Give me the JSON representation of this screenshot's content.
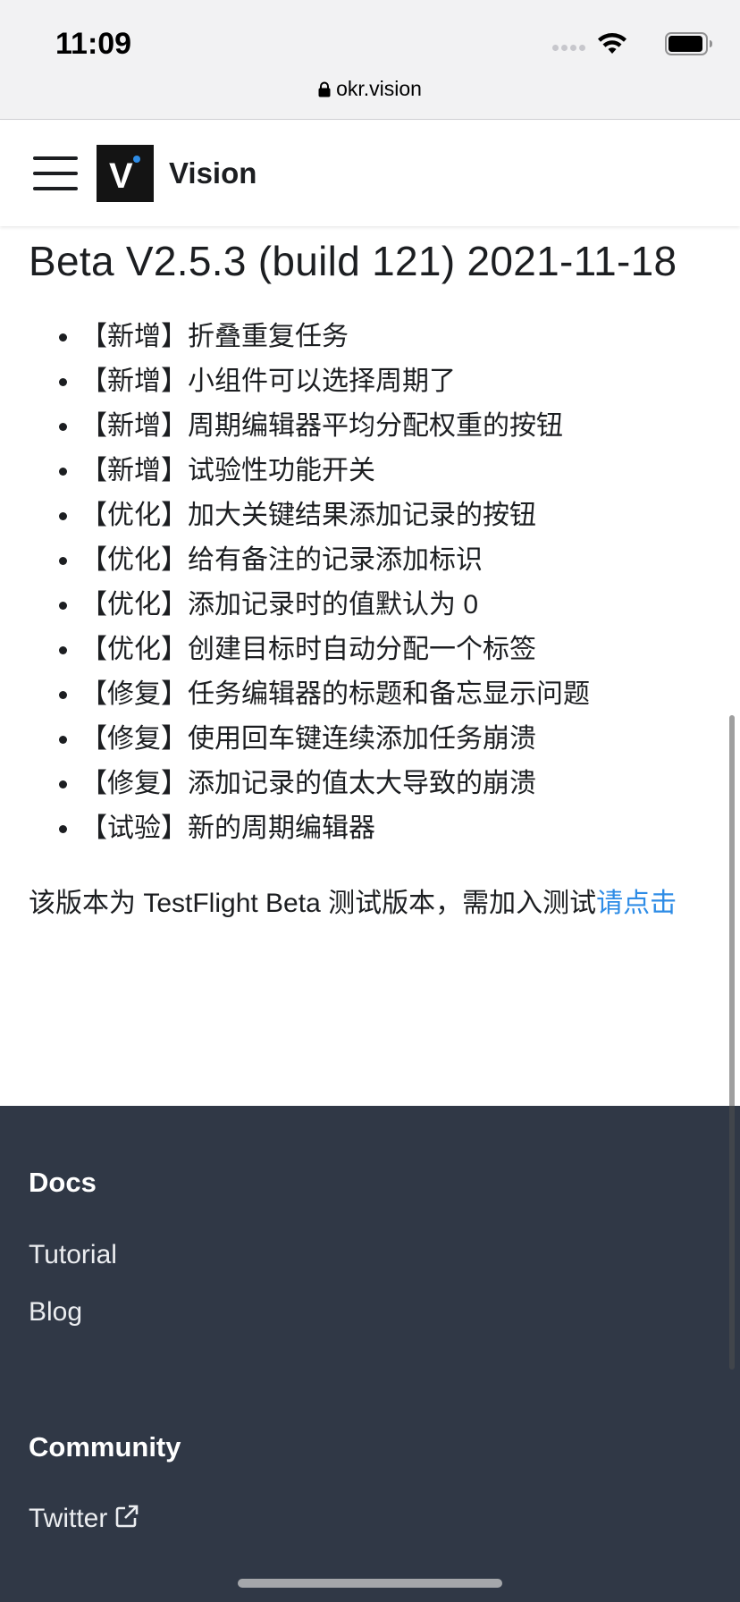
{
  "status_bar": {
    "time": "11:09",
    "url": "okr.vision"
  },
  "navbar": {
    "brand_name": "Vision",
    "logo_letter": "V"
  },
  "content": {
    "release_title": "Beta V2.5.3 (build 121) 2021-11-18",
    "changes": [
      {
        "tag": "【新增】",
        "text": "折叠重复任务"
      },
      {
        "tag": "【新增】",
        "text": "小组件可以选择周期了"
      },
      {
        "tag": "【新增】",
        "text": "周期编辑器平均分配权重的按钮"
      },
      {
        "tag": "【新增】",
        "text": "试验性功能开关"
      },
      {
        "tag": "【优化】",
        "text": "加大关键结果添加记录的按钮"
      },
      {
        "tag": "【优化】",
        "text": "给有备注的记录添加标识"
      },
      {
        "tag": "【优化】",
        "text": "添加记录时的值默认为 0"
      },
      {
        "tag": "【优化】",
        "text": "创建目标时自动分配一个标签"
      },
      {
        "tag": "【修复】",
        "text": "任务编辑器的标题和备忘显示问题"
      },
      {
        "tag": "【修复】",
        "text": "使用回车键连续添加任务崩溃"
      },
      {
        "tag": "【修复】",
        "text": "添加记录的值太大导致的崩溃"
      },
      {
        "tag": "【试验】",
        "text": "新的周期编辑器"
      }
    ],
    "note_text": "该版本为 TestFlight Beta 测试版本，需加入测试",
    "note_link": "请点击"
  },
  "footer": {
    "docs_title": "Docs",
    "docs_links": [
      "Tutorial",
      "Blog"
    ],
    "community_title": "Community",
    "community_links": [
      "Twitter"
    ]
  },
  "colors": {
    "link": "#2e8ce6",
    "footer_bg": "#303846",
    "accent_dot": "#2e8ce6"
  }
}
